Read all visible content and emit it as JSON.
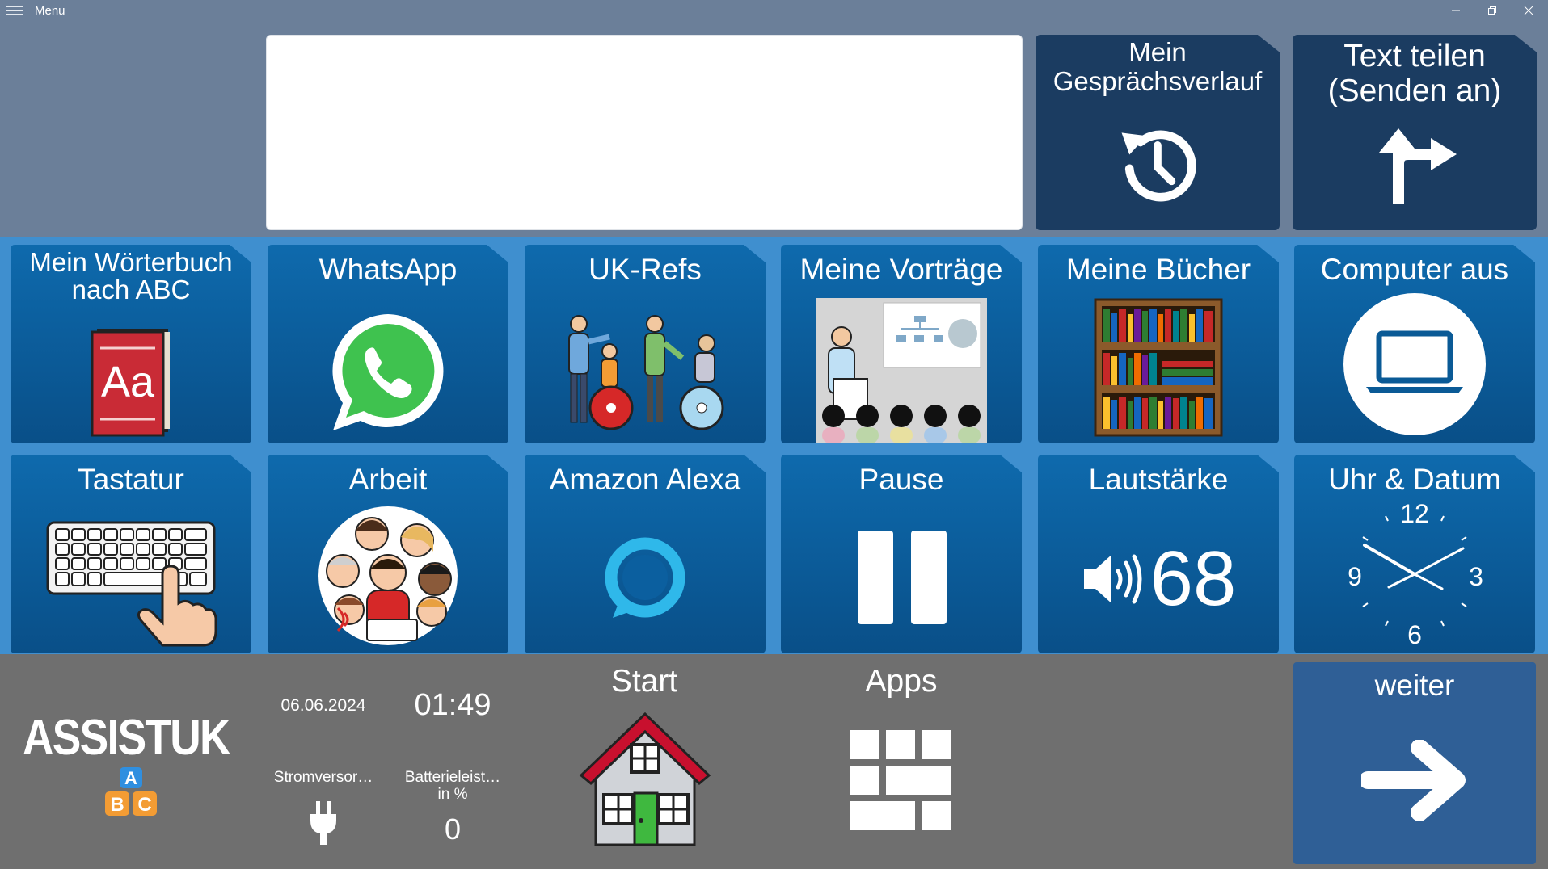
{
  "titlebar": {
    "menu_label": "Menu",
    "minimize_icon": "minimize-icon",
    "restore_icon": "restore-icon",
    "close_icon": "close-icon"
  },
  "message_box": {
    "text": ""
  },
  "top_tiles": {
    "history": {
      "label_line1": "Mein",
      "label_line2": "Gesprächsverlauf",
      "icon": "history-icon"
    },
    "share": {
      "label_line1": "Text teilen",
      "label_line2": "(Senden an)",
      "icon": "share-arrow-icon"
    }
  },
  "tiles": {
    "dictionary": {
      "label_line1": "Mein Wörterbuch",
      "label_line2": "nach ABC",
      "icon": "dictionary-book-icon",
      "book_text": "Aa"
    },
    "whatsapp": {
      "label": "WhatsApp",
      "icon": "whatsapp-icon"
    },
    "ukrefs": {
      "label": "UK-Refs",
      "icon": "people-wheelchair-icon"
    },
    "talks": {
      "label": "Meine Vorträge",
      "icon": "presentation-icon"
    },
    "books": {
      "label": "Meine Bücher",
      "icon": "bookshelf-icon"
    },
    "shutdown": {
      "label": "Computer aus",
      "icon": "laptop-icon"
    },
    "keyboard": {
      "label": "Tastatur",
      "icon": "keyboard-hand-icon"
    },
    "work": {
      "label": "Arbeit",
      "icon": "colleagues-icon"
    },
    "alexa": {
      "label": "Amazon Alexa",
      "icon": "alexa-ring-icon"
    },
    "pause": {
      "label": "Pause",
      "icon": "pause-icon"
    },
    "volume": {
      "label": "Lautstärke",
      "icon": "speaker-icon",
      "value": "68"
    },
    "clock": {
      "label": "Uhr & Datum",
      "icon": "analog-clock-icon",
      "num12": "12",
      "num3": "3",
      "num6": "6",
      "num9": "9"
    }
  },
  "bottom": {
    "brand_text": "ASSISTUK",
    "brand_icon": "abc-blocks-icon",
    "date": "06.06.2024",
    "time": "01:49",
    "power_label": "Stromversor…",
    "power_icon": "plug-icon",
    "battery_label_line1": "Batterieleist…",
    "battery_label_line2": "in %",
    "battery_value": "0",
    "start_label": "Start",
    "start_icon": "house-icon",
    "apps_label": "Apps",
    "apps_icon": "apps-grid-icon",
    "next_label": "weiter",
    "next_icon": "arrow-right-icon"
  },
  "colors": {
    "background": "#6b7f99",
    "tile_band": "#3f8fcf",
    "tile": "#0b5c9a",
    "top_tile": "#1b3c61",
    "bottom_bar": "#6f6f6f",
    "next_tile": "#2f5f96"
  }
}
